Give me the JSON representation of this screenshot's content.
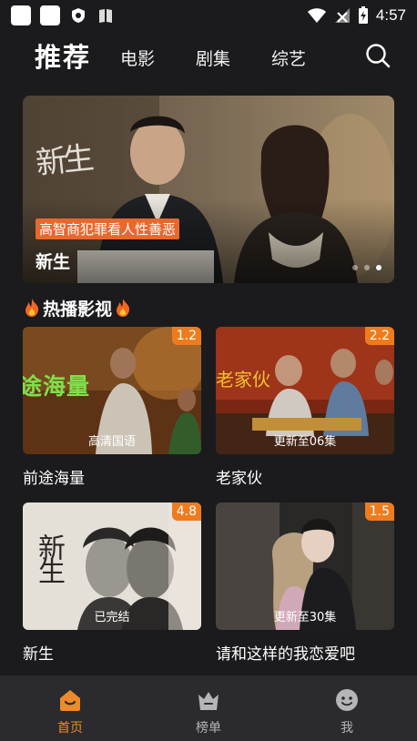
{
  "status_bar": {
    "time": "4:57"
  },
  "top_nav": {
    "tabs": [
      {
        "label": "推荐"
      },
      {
        "label": "电影"
      },
      {
        "label": "剧集"
      },
      {
        "label": "综艺"
      }
    ],
    "search_icon": "search-icon"
  },
  "banner": {
    "poster_caption": "新生",
    "tag": "高智商犯罪看人性善恶",
    "title": "新生",
    "dots": 3,
    "active_dot": 3
  },
  "hot_section": {
    "title": "热播影视",
    "items": [
      {
        "title": "前途海量",
        "score": "1.2",
        "note": "高清国语",
        "poster_text": "途海量"
      },
      {
        "title": "老家伙",
        "score": "2.2",
        "note": "更新至06集",
        "poster_text": "老家伙"
      },
      {
        "title": "新生",
        "score": "4.8",
        "note": "已完结",
        "poster_text": "新生"
      },
      {
        "title": "请和这样的我恋爱吧",
        "score": "1.5",
        "note": "更新至30集",
        "poster_text": ""
      }
    ]
  },
  "bottom_nav": {
    "items": [
      {
        "label": "首页",
        "icon": "home-icon",
        "active": true
      },
      {
        "label": "榜单",
        "icon": "crown-icon",
        "active": false
      },
      {
        "label": "我",
        "icon": "smile-icon",
        "active": false
      }
    ]
  },
  "colors": {
    "accent": "#ee7c1e",
    "background": "#1b1b1e",
    "bottom_bar": "#2b2b2f"
  }
}
